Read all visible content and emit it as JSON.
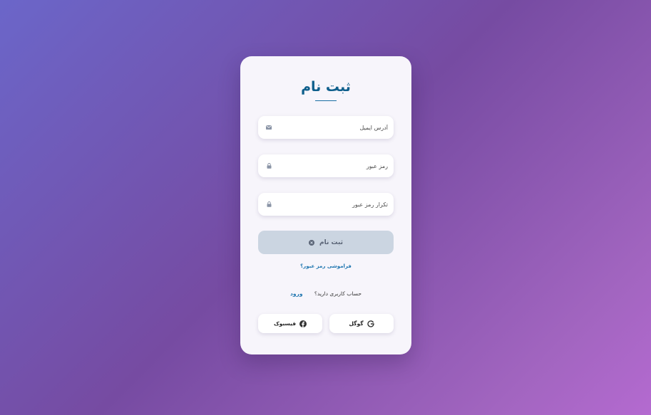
{
  "form": {
    "title": "ثبت نام",
    "email_placeholder": "آدرس ایمیل",
    "password_placeholder": "رمز عبور",
    "confirm_placeholder": "تکرار رمز عبور",
    "submit_label": "ثبت نام",
    "forgot_label": "فراموشی رمز عبور؟",
    "has_account_text": "حساب کاربری دارید؟",
    "login_label": "ورود",
    "google_label": "گوگل",
    "facebook_label": "فیسبوک"
  },
  "icons": {
    "email": "envelope-icon",
    "password": "lock-icon",
    "confirm": "lock-icon",
    "submit": "spinner-icon",
    "google": "google-icon",
    "facebook": "facebook-icon"
  },
  "colors": {
    "accent": "#1f76b0",
    "title": "#0f5f8c",
    "button_disabled": "#cbd5e1",
    "card": "#f7f5fb"
  }
}
